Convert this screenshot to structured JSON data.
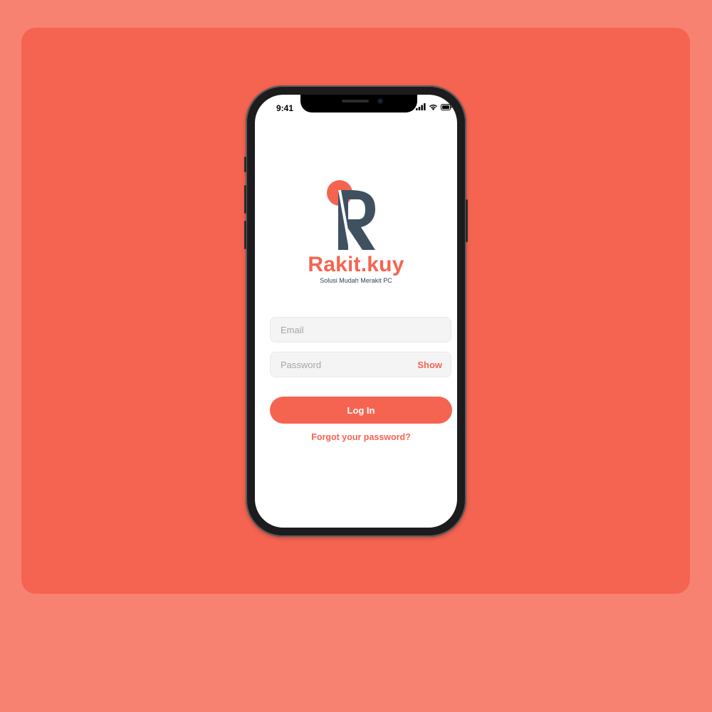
{
  "status_bar": {
    "time": "9:41",
    "icons": [
      "cellular-signal-icon",
      "wifi-icon",
      "battery-icon"
    ]
  },
  "logo": {
    "mark_letter": "R",
    "brand_name": "Rakit.kuy",
    "tagline": "Solusi Mudah Merakit PC"
  },
  "form": {
    "email_placeholder": "Email",
    "password_placeholder": "Password",
    "show_label": "Show",
    "login_label": "Log In",
    "forgot_label": "Forgot your password?"
  },
  "colors": {
    "brand": "#f56451",
    "background": "#f88272",
    "logo_dark": "#3f5160"
  }
}
